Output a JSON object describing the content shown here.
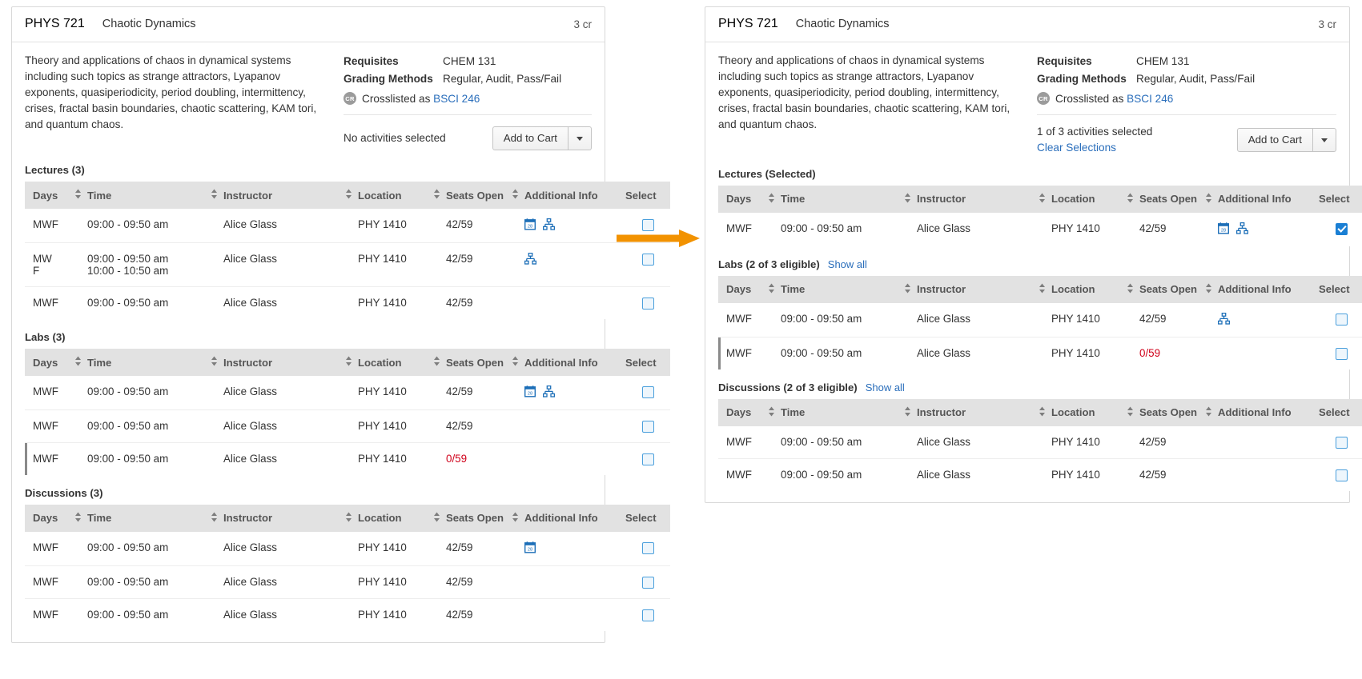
{
  "course": {
    "code": "PHYS 721",
    "title": "Chaotic Dynamics",
    "credits": "3 cr",
    "description": "Theory and applications of chaos in dynamical systems including such topics as strange attractors, Lyapanov exponents, quasiperiodicity, period doubling, intermittency, crises, fractal basin boundaries, chaotic scattering, KAM tori, and quantum chaos.",
    "requisites_label": "Requisites",
    "requisites_value": "CHEM 131",
    "grading_label": "Grading Methods",
    "grading_value": "Regular, Audit, Pass/Fail",
    "crosslist_badge": "CR",
    "crosslist_text": "Crosslisted as",
    "crosslist_link": "BSCI 246"
  },
  "columns": {
    "days": "Days",
    "time": "Time",
    "instructor": "Instructor",
    "location": "Location",
    "seats": "Seats Open",
    "info": "Additional Info",
    "select": "Select"
  },
  "buttons": {
    "add_to_cart": "Add to Cart",
    "caret_icon": "chevron-down-icon"
  },
  "left_panel": {
    "cart_status": "No activities selected",
    "sections": [
      {
        "title": "Lectures (3)",
        "rows": [
          {
            "days": "MWF",
            "days2": "",
            "time": "09:00 - 09:50 am",
            "time2": "",
            "instructor": "Alice Glass",
            "location": "PHY 1410",
            "seats": "42/59",
            "full": false,
            "icons": [
              "calendar-icon",
              "sitemap-icon"
            ],
            "checked": false,
            "waitlist": false,
            "selected": false
          },
          {
            "days": "MW",
            "days2": "F",
            "time": "09:00 - 09:50 am",
            "time2": "10:00 - 10:50 am",
            "instructor": "Alice Glass",
            "location": "PHY 1410",
            "seats": "42/59",
            "full": false,
            "icons": [
              "sitemap-icon"
            ],
            "checked": false,
            "waitlist": false,
            "selected": false
          },
          {
            "days": "MWF",
            "days2": "",
            "time": "09:00 - 09:50 am",
            "time2": "",
            "instructor": "Alice Glass",
            "location": "PHY 1410",
            "seats": "42/59",
            "full": false,
            "icons": [],
            "checked": false,
            "waitlist": false,
            "selected": false
          }
        ]
      },
      {
        "title": "Labs (3)",
        "rows": [
          {
            "days": "MWF",
            "days2": "",
            "time": "09:00 - 09:50 am",
            "time2": "",
            "instructor": "Alice Glass",
            "location": "PHY 1410",
            "seats": "42/59",
            "full": false,
            "icons": [
              "calendar-icon",
              "sitemap-icon"
            ],
            "checked": false,
            "waitlist": false,
            "selected": false
          },
          {
            "days": "MWF",
            "days2": "",
            "time": "09:00 - 09:50 am",
            "time2": "",
            "instructor": "Alice Glass",
            "location": "PHY 1410",
            "seats": "42/59",
            "full": false,
            "icons": [],
            "checked": false,
            "waitlist": false,
            "selected": false
          },
          {
            "days": "MWF",
            "days2": "",
            "time": "09:00 - 09:50 am",
            "time2": "",
            "instructor": "Alice Glass",
            "location": "PHY 1410",
            "seats": "0/59",
            "full": true,
            "icons": [],
            "checked": false,
            "waitlist": true,
            "selected": false
          }
        ]
      },
      {
        "title": "Discussions (3)",
        "rows": [
          {
            "days": "MWF",
            "days2": "",
            "time": "09:00 - 09:50 am",
            "time2": "",
            "instructor": "Alice Glass",
            "location": "PHY 1410",
            "seats": "42/59",
            "full": false,
            "icons": [
              "calendar-icon"
            ],
            "checked": false,
            "waitlist": false,
            "selected": false
          },
          {
            "days": "MWF",
            "days2": "",
            "time": "09:00 - 09:50 am",
            "time2": "",
            "instructor": "Alice Glass",
            "location": "PHY 1410",
            "seats": "42/59",
            "full": false,
            "icons": [],
            "checked": false,
            "waitlist": false,
            "selected": false
          },
          {
            "days": "MWF",
            "days2": "",
            "time": "09:00 - 09:50 am",
            "time2": "",
            "instructor": "Alice Glass",
            "location": "PHY 1410",
            "seats": "42/59",
            "full": false,
            "icons": [],
            "checked": false,
            "waitlist": false,
            "selected": false
          }
        ]
      }
    ]
  },
  "right_panel": {
    "cart_status": "1 of 3 activities selected",
    "clear_link": "Clear Selections",
    "sections": [
      {
        "title": "Lectures (Selected)",
        "showall": "",
        "rows": [
          {
            "days": "MWF",
            "days2": "",
            "time": "09:00 - 09:50 am",
            "time2": "",
            "instructor": "Alice Glass",
            "location": "PHY 1410",
            "seats": "42/59",
            "full": false,
            "icons": [
              "calendar-icon",
              "sitemap-icon"
            ],
            "checked": true,
            "waitlist": false,
            "selected": true
          }
        ]
      },
      {
        "title": "Labs (2 of 3 eligible)",
        "showall": "Show all",
        "rows": [
          {
            "days": "MWF",
            "days2": "",
            "time": "09:00 - 09:50 am",
            "time2": "",
            "instructor": "Alice Glass",
            "location": "PHY 1410",
            "seats": "42/59",
            "full": false,
            "icons": [
              "sitemap-icon"
            ],
            "checked": false,
            "waitlist": false,
            "selected": false
          },
          {
            "days": "MWF",
            "days2": "",
            "time": "09:00 - 09:50 am",
            "time2": "",
            "instructor": "Alice Glass",
            "location": "PHY 1410",
            "seats": "0/59",
            "full": true,
            "icons": [],
            "checked": false,
            "waitlist": true,
            "selected": false
          }
        ]
      },
      {
        "title": "Discussions (2 of 3 eligible)",
        "showall": "Show all",
        "rows": [
          {
            "days": "MWF",
            "days2": "",
            "time": "09:00 - 09:50 am",
            "time2": "",
            "instructor": "Alice Glass",
            "location": "PHY 1410",
            "seats": "42/59",
            "full": false,
            "icons": [],
            "checked": false,
            "waitlist": false,
            "selected": false
          },
          {
            "days": "MWF",
            "days2": "",
            "time": "09:00 - 09:50 am",
            "time2": "",
            "instructor": "Alice Glass",
            "location": "PHY 1410",
            "seats": "42/59",
            "full": false,
            "icons": [],
            "checked": false,
            "waitlist": false,
            "selected": false
          }
        ]
      }
    ]
  },
  "annotation": {
    "arrow_icon": "arrow-right-annotation",
    "color": "#F29200"
  },
  "colors": {
    "link": "#2a6ebb",
    "header_bg": "#e2e2e2",
    "selected_row_bg": "#eaf3fb",
    "full_seats": "#d0021b",
    "checkbox_blue": "#1a7fd4",
    "annotation_orange": "#F29200"
  }
}
